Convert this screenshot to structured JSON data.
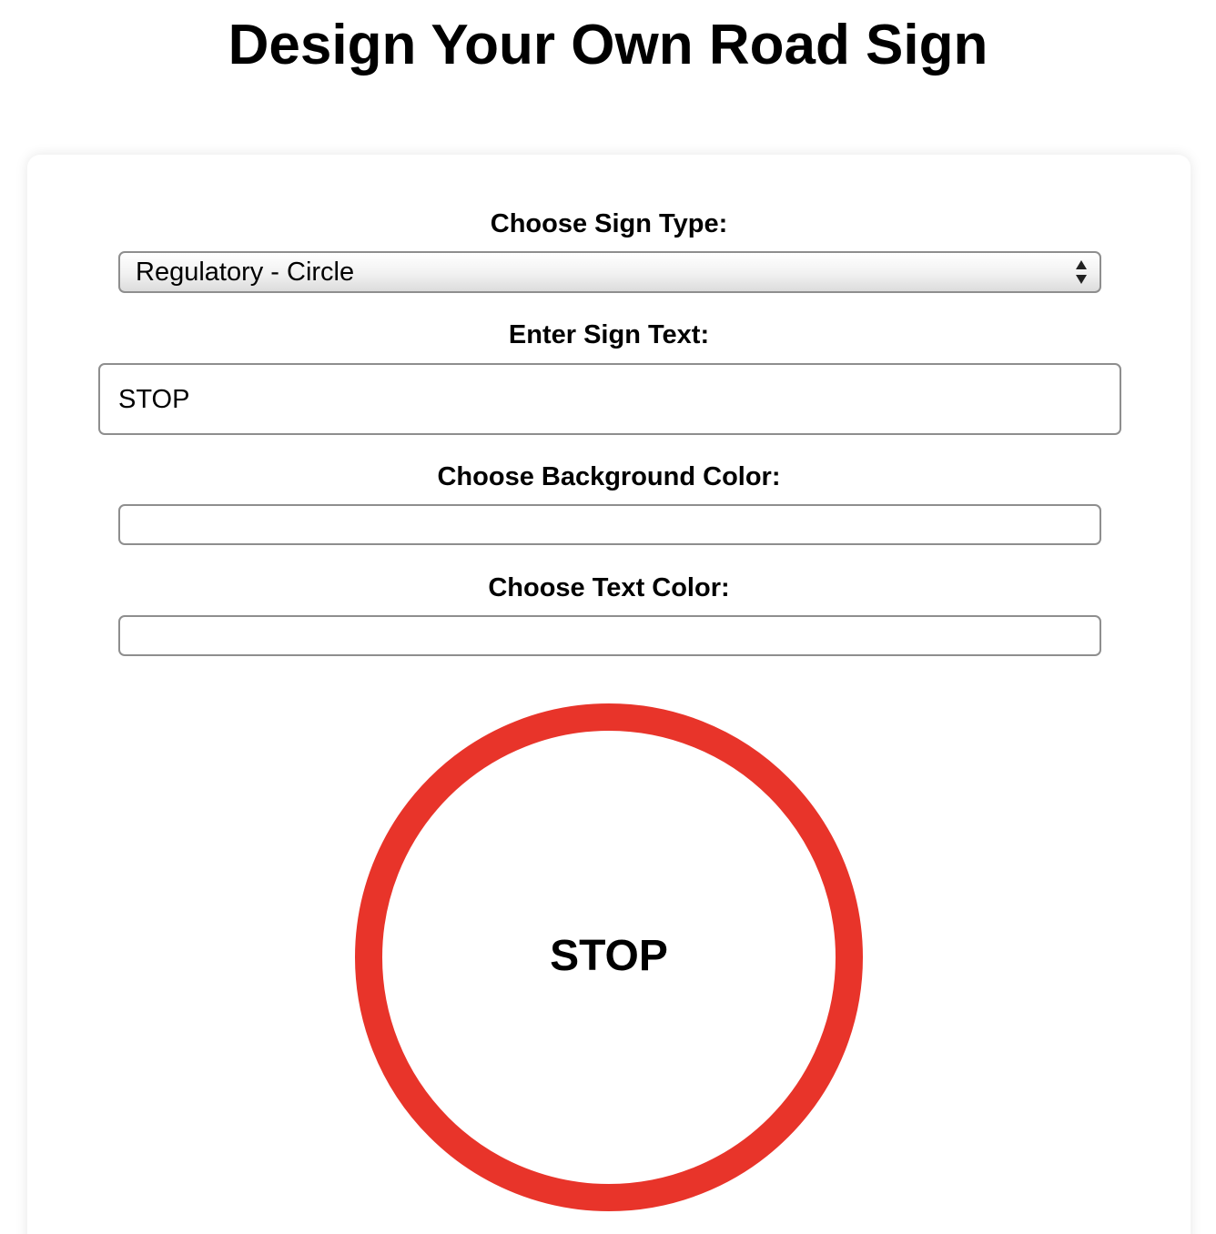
{
  "page": {
    "title": "Design Your Own Road Sign"
  },
  "form": {
    "sign_type": {
      "label": "Choose Sign Type:",
      "selected": "Regulatory - Circle"
    },
    "sign_text": {
      "label": "Enter Sign Text:",
      "value": "STOP"
    },
    "background_color": {
      "label": "Choose Background Color:"
    },
    "text_color": {
      "label": "Choose Text Color:"
    }
  },
  "preview": {
    "text": "STOP",
    "border_color": "#e8342a",
    "fill_color": "#ffffff",
    "text_color": "#000000"
  },
  "icons": {
    "select_arrows": "up-down-chevron-icon"
  }
}
